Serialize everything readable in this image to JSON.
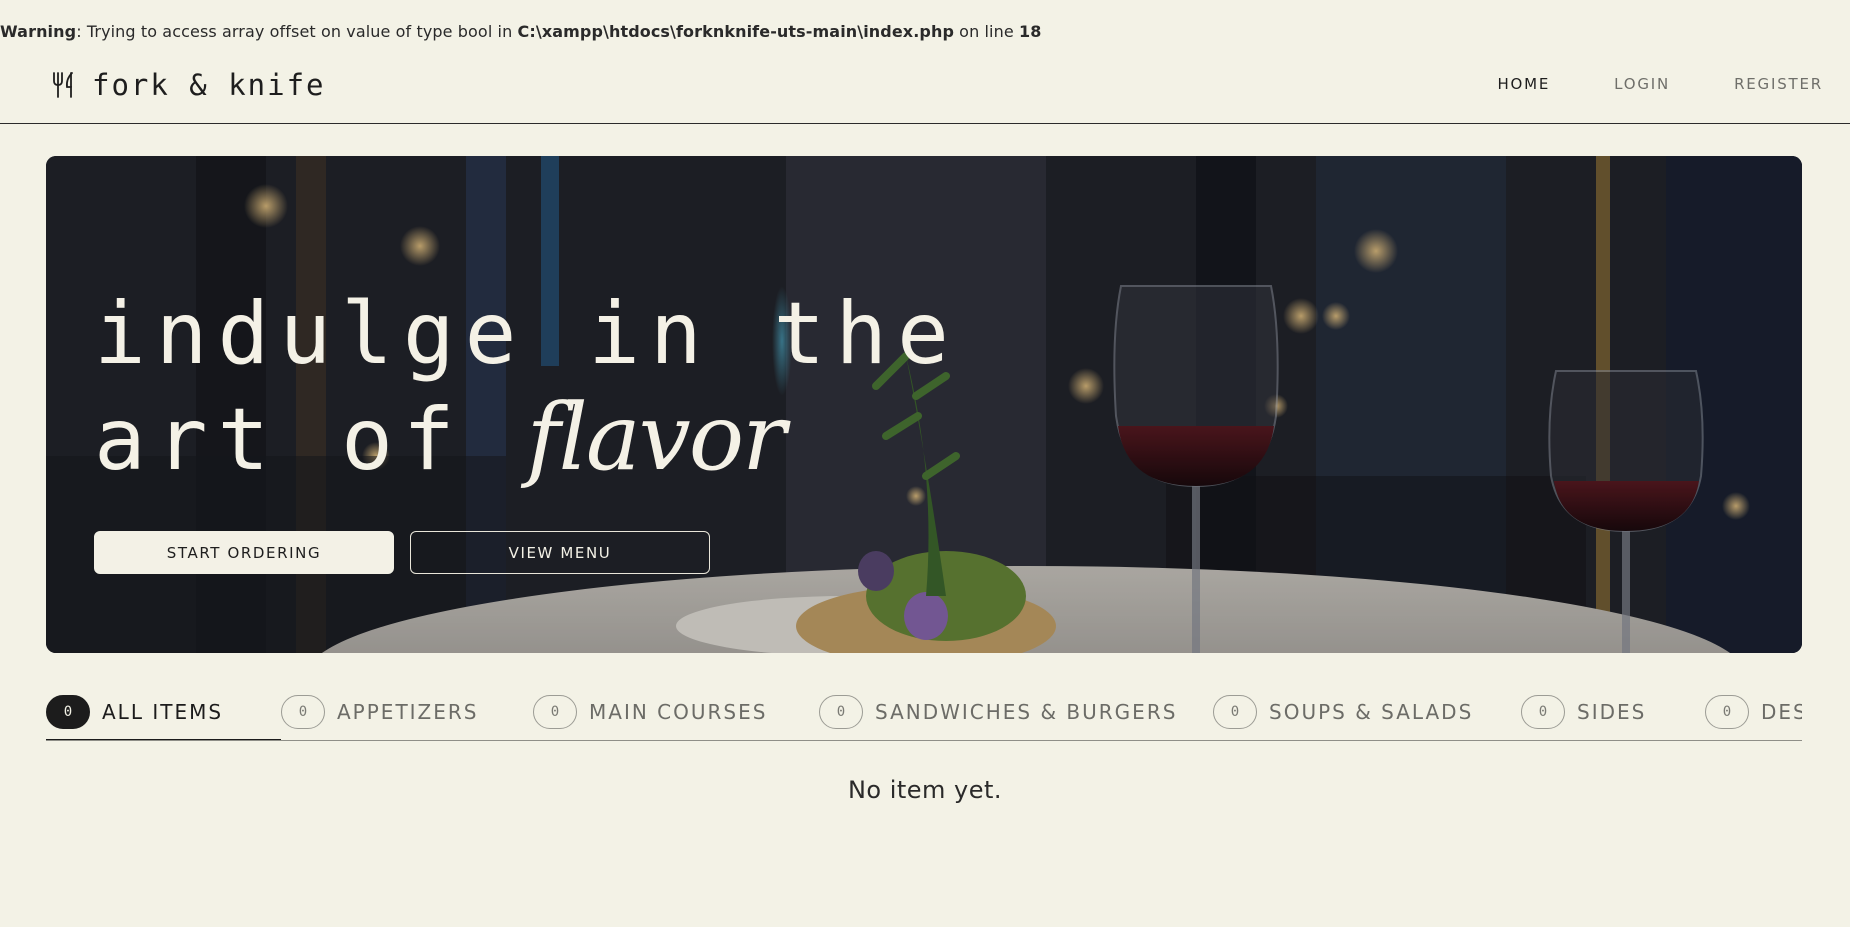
{
  "warning": {
    "label": "Warning",
    "message": ": Trying to access array offset on value of type bool in ",
    "path": "C:\\xampp\\htdocs\\forknknife-uts-main\\index.php",
    "line_text": " on line ",
    "line_number": "18"
  },
  "header": {
    "brand_icon": "fork-knife-icon",
    "brand_name": "fork & knife",
    "nav": [
      {
        "label": "HOME",
        "active": true
      },
      {
        "label": "LOGIN",
        "active": false
      },
      {
        "label": "REGISTER",
        "active": false
      }
    ]
  },
  "hero": {
    "title_line1": "indulge in the",
    "title_line2": "art of ",
    "title_accent": "flavor",
    "primary_button": "START ORDERING",
    "secondary_button": "VIEW MENU"
  },
  "tabs": [
    {
      "count": "0",
      "label": "ALL ITEMS",
      "active": true
    },
    {
      "count": "0",
      "label": "APPETIZERS",
      "active": false
    },
    {
      "count": "0",
      "label": "MAIN COURSES",
      "active": false
    },
    {
      "count": "0",
      "label": "SANDWICHES & BURGERS",
      "active": false
    },
    {
      "count": "0",
      "label": "SOUPS & SALADS",
      "active": false
    },
    {
      "count": "0",
      "label": "SIDES",
      "active": false
    },
    {
      "count": "0",
      "label": "DES",
      "active": false
    }
  ],
  "empty_state": "No item yet.",
  "colors": {
    "background": "#f3f2e6",
    "ink": "#1c1c1c",
    "muted": "#6c6c67"
  }
}
